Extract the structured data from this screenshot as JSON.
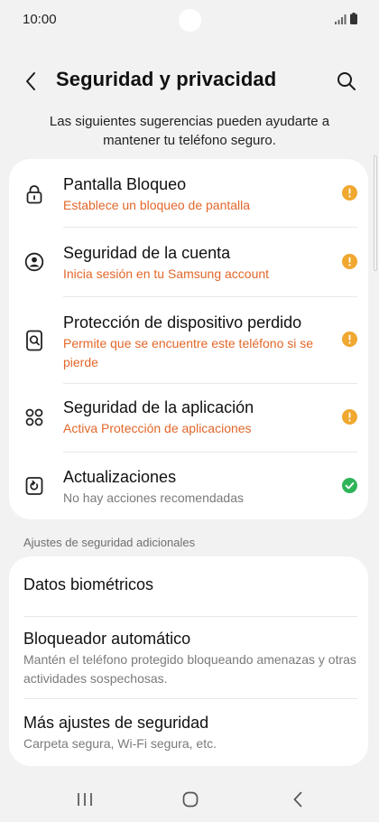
{
  "status_bar": {
    "time": "10:00"
  },
  "header": {
    "title": "Seguridad y privacidad"
  },
  "subtitle": "Las siguientes sugerencias pueden ayudarte a mantener tu teléfono seguro.",
  "main_items": [
    {
      "title": "Pantalla Bloqueo",
      "desc": "Establece un bloqueo de pantalla",
      "icon": "lock-icon",
      "status": "warning"
    },
    {
      "title": "Seguridad de la cuenta",
      "desc": "Inicia sesión en tu Samsung account",
      "icon": "account-icon",
      "status": "warning"
    },
    {
      "title": "Protección de dispositivo perdido",
      "desc": "Permite que se encuentre este teléfono si se pierde",
      "icon": "find-device-icon",
      "status": "warning"
    },
    {
      "title": "Seguridad de la aplicación",
      "desc": "Activa Protección de aplicaciones",
      "icon": "apps-icon",
      "status": "warning"
    },
    {
      "title": "Actualizaciones",
      "desc": "No hay acciones recomendadas",
      "icon": "update-icon",
      "status": "ok"
    }
  ],
  "section_label": "Ajustes de seguridad adicionales",
  "extra_items": [
    {
      "title": "Datos biométricos"
    },
    {
      "title": "Bloqueador automático",
      "desc": "Mantén el teléfono protegido bloqueando amenazas y otras actividades sospechosas."
    },
    {
      "title": "Más ajustes de seguridad",
      "desc": "Carpeta segura, Wi-Fi segura, etc."
    }
  ],
  "colors": {
    "warning": "#f0a830",
    "ok": "#2fb45a",
    "accent_text": "#e2672a"
  }
}
